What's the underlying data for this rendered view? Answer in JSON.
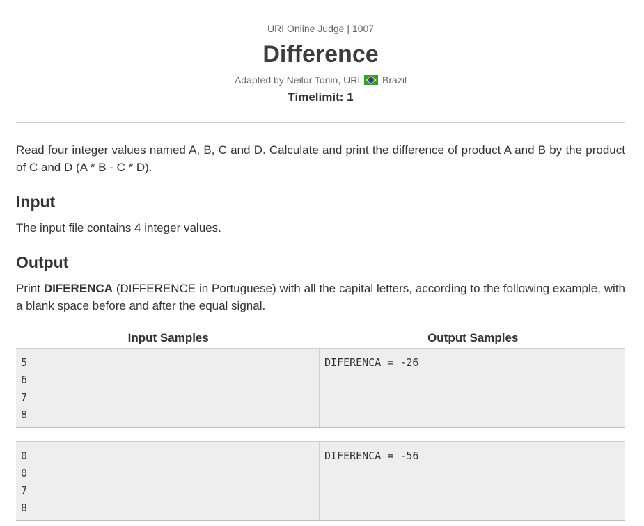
{
  "header": {
    "judge_line": "URI Online Judge | 1007",
    "title": "Difference",
    "author_prefix": "Adapted by Neilor Tonin, URI",
    "author_country": "Brazil",
    "timelimit": "Timelimit: 1"
  },
  "description": "Read four integer values named A, B, C and D. Calculate and print the difference of product A and B by the product of C and D (A * B - C * D).",
  "input": {
    "title": "Input",
    "text": "The input file contains 4 integer values."
  },
  "output": {
    "title": "Output",
    "text_before": "Print ",
    "bold": "DIFERENCA",
    "text_after": " (DIFFERENCE in Portuguese) with all the capital letters, according to the following example, with a blank space before and after the equal signal."
  },
  "samples": {
    "input_header": "Input Samples",
    "output_header": "Output Samples",
    "rows": [
      {
        "input": "5\n6\n7\n8",
        "output": "DIFERENCA = -26"
      },
      {
        "input": "0\n0\n7\n8",
        "output": "DIFERENCA = -56"
      }
    ]
  }
}
